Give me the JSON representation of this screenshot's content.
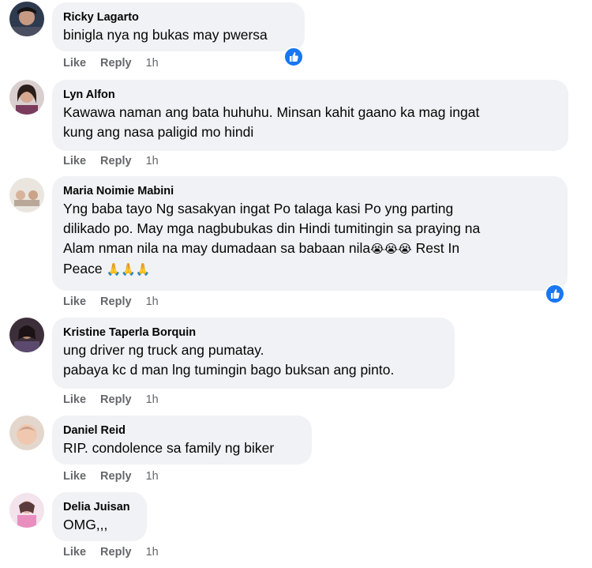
{
  "colors": {
    "bubble": "#f0f2f5",
    "link": "#65676b",
    "like_blue": "#1877f2"
  },
  "comments": [
    {
      "author": "Ricky Lagarto",
      "lines": [
        "binigla nya ng bukas may pwersa"
      ],
      "like": "Like",
      "reply": "Reply",
      "time": "1h",
      "reaction": "like-icon"
    },
    {
      "author": "Lyn Alfon",
      "lines": [
        "Kawawa naman ang bata huhuhu. Minsan kahit gaano ka mag ingat",
        "kung ang nasa paligid mo hindi"
      ],
      "like": "Like",
      "reply": "Reply",
      "time": "1h"
    },
    {
      "author": "Maria Noimie Mabini",
      "lines": [
        "Yng baba tayo Ng sasakyan ingat Po talaga kasi Po yng parting",
        "dilikado po. May mga nagbubukas din Hindi tumitingin sa praying na",
        "Alam nman nila na may dumadaan sa babaan nila",
        "Peace"
      ],
      "line3_tail": "Rest In",
      "emoji_crying": "😭😭😭",
      "emoji_pray": "🙏🙏🙏",
      "like": "Like",
      "reply": "Reply",
      "time": "1h",
      "reaction": "like-icon"
    },
    {
      "author": "Kristine Taperla Borquin",
      "lines": [
        "ung driver ng truck ang pumatay.",
        "pabaya kc d man lng tumingin bago buksan ang pinto."
      ],
      "like": "Like",
      "reply": "Reply",
      "time": "1h"
    },
    {
      "author": "Daniel Reid",
      "lines": [
        "RIP. condolence sa family ng biker"
      ],
      "like": "Like",
      "reply": "Reply",
      "time": "1h"
    },
    {
      "author": "Delia Juisan",
      "lines": [
        "OMG,,,"
      ],
      "like": "Like",
      "reply": "Reply",
      "time": "1h"
    }
  ]
}
